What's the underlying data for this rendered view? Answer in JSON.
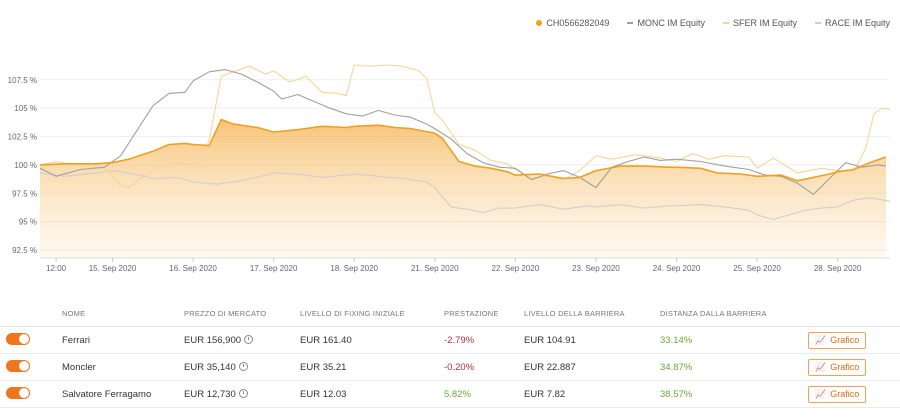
{
  "chart_data": {
    "type": "line",
    "yticks": [
      "107.5 %",
      "105 %",
      "102.5 %",
      "100 %",
      "97.5 %",
      "95 %",
      "92.5 %"
    ],
    "ytick_values": [
      107.5,
      105,
      102.5,
      100,
      97.5,
      95,
      92.5
    ],
    "ylim": [
      91.8,
      110.3
    ],
    "xticks": [
      "12:00",
      "15. Sep 2020",
      "16. Sep 2020",
      "17. Sep 2020",
      "18. Sep 2020",
      "21. Sep 2020",
      "22. Sep 2020",
      "23. Sep 2020",
      "24. Sep 2020",
      "25. Sep 2020",
      "28. Sep 2020"
    ],
    "xtick_positions": [
      0.3,
      1,
      2,
      3,
      4,
      5,
      6,
      7,
      8,
      9,
      10
    ],
    "xlim": [
      0.1,
      10.65
    ],
    "grid": true,
    "legend_position": "top-right",
    "series": [
      {
        "name": "CH0566282049",
        "color": "#f0a020",
        "marker": "dot",
        "fill": true,
        "x": [
          0.1,
          0.4,
          0.8,
          1.0,
          1.2,
          1.5,
          1.7,
          1.9,
          2.0,
          2.2,
          2.35,
          2.5,
          2.8,
          3.0,
          3.3,
          3.6,
          3.9,
          4.0,
          4.3,
          4.5,
          4.7,
          5.0,
          5.1,
          5.3,
          5.5,
          5.7,
          5.9,
          6.0,
          6.3,
          6.6,
          6.8,
          7.0,
          7.3,
          7.6,
          7.9,
          8.0,
          8.3,
          8.5,
          8.8,
          9.0,
          9.3,
          9.5,
          9.7,
          9.9,
          10.0,
          10.2,
          10.4,
          10.6
        ],
        "y": [
          100.0,
          100.1,
          100.1,
          100.2,
          100.5,
          101.2,
          101.8,
          101.9,
          101.8,
          101.7,
          104.0,
          103.6,
          103.3,
          102.9,
          103.1,
          103.4,
          103.3,
          103.4,
          103.5,
          103.3,
          103.2,
          102.8,
          102.3,
          100.3,
          99.9,
          99.7,
          99.4,
          99.1,
          99.2,
          98.8,
          98.9,
          99.5,
          99.9,
          99.9,
          99.8,
          99.8,
          99.7,
          99.3,
          99.2,
          99.0,
          99.1,
          98.6,
          98.9,
          99.2,
          99.4,
          99.6,
          100.2,
          100.7
        ]
      },
      {
        "name": "MONC IM Equity",
        "color": "#a0a0a0",
        "marker": "dash",
        "x": [
          0.1,
          0.3,
          0.6,
          0.9,
          1.1,
          1.3,
          1.5,
          1.7,
          1.9,
          2.0,
          2.2,
          2.4,
          2.6,
          2.8,
          3.0,
          3.1,
          3.3,
          3.5,
          3.7,
          3.9,
          4.1,
          4.3,
          4.5,
          4.7,
          4.9,
          5.0,
          5.2,
          5.4,
          5.6,
          5.8,
          6.0,
          6.2,
          6.4,
          6.6,
          6.8,
          7.0,
          7.2,
          7.4,
          7.6,
          7.8,
          8.0,
          8.3,
          8.6,
          8.9,
          9.1,
          9.3,
          9.5,
          9.7,
          9.9,
          10.1,
          10.3,
          10.5,
          10.6
        ],
        "y": [
          99.7,
          99.0,
          99.6,
          99.8,
          100.8,
          103.0,
          105.2,
          106.3,
          106.4,
          107.4,
          108.2,
          108.4,
          108.0,
          107.3,
          106.5,
          105.8,
          106.2,
          105.6,
          105.0,
          104.5,
          104.3,
          104.8,
          104.4,
          104.2,
          103.6,
          103.2,
          102.3,
          101.0,
          100.2,
          99.8,
          99.7,
          98.7,
          99.2,
          99.5,
          98.9,
          98.0,
          99.8,
          100.3,
          100.7,
          100.4,
          100.5,
          100.3,
          99.9,
          99.6,
          99.1,
          99.0,
          98.4,
          97.4,
          98.8,
          100.2,
          99.8,
          100.0,
          99.9
        ]
      },
      {
        "name": "SFER IM Equity",
        "color": "#f7d59a",
        "marker": "dash",
        "x": [
          0.1,
          0.3,
          0.6,
          0.9,
          1.1,
          1.2,
          1.4,
          1.6,
          1.8,
          1.95,
          2.0,
          2.1,
          2.2,
          2.35,
          2.5,
          2.7,
          2.9,
          3.0,
          3.2,
          3.4,
          3.6,
          3.8,
          3.9,
          4.0,
          4.2,
          4.4,
          4.6,
          4.8,
          4.9,
          5.0,
          5.1,
          5.3,
          5.5,
          5.7,
          5.9,
          6.0,
          6.2,
          6.4,
          6.6,
          6.8,
          7.0,
          7.2,
          7.5,
          7.8,
          8.0,
          8.2,
          8.4,
          8.6,
          8.9,
          9.0,
          9.2,
          9.5,
          9.8,
          10.0,
          10.2,
          10.35,
          10.45,
          10.55,
          10.65
        ],
        "y": [
          100.0,
          100.3,
          99.9,
          99.7,
          98.2,
          98.0,
          99.1,
          99.8,
          100.2,
          100.0,
          100.1,
          100.3,
          102.2,
          107.8,
          108.2,
          108.7,
          108.0,
          108.3,
          107.3,
          107.8,
          106.4,
          106.3,
          106.1,
          108.8,
          108.7,
          108.8,
          108.7,
          108.3,
          107.6,
          104.6,
          103.9,
          101.8,
          101.3,
          100.4,
          100.1,
          99.6,
          98.8,
          99.0,
          98.7,
          99.5,
          100.8,
          100.5,
          100.9,
          100.6,
          100.3,
          101.0,
          100.5,
          100.8,
          100.7,
          99.7,
          100.6,
          99.3,
          99.7,
          99.5,
          99.4,
          101.5,
          104.5,
          105.0,
          104.9
        ]
      },
      {
        "name": "RACE IM Equity",
        "color": "#cfcfcf",
        "marker": "dash",
        "x": [
          0.1,
          0.4,
          0.8,
          1.0,
          1.2,
          1.5,
          1.8,
          2.0,
          2.3,
          2.6,
          2.9,
          3.0,
          3.3,
          3.6,
          3.9,
          4.0,
          4.3,
          4.6,
          4.9,
          5.0,
          5.2,
          5.4,
          5.6,
          5.8,
          6.0,
          6.3,
          6.6,
          6.9,
          7.0,
          7.3,
          7.6,
          7.9,
          8.0,
          8.3,
          8.6,
          8.9,
          9.0,
          9.2,
          9.4,
          9.6,
          9.8,
          10.0,
          10.2,
          10.4,
          10.65
        ],
        "y": [
          99.3,
          99.0,
          99.3,
          99.5,
          99.3,
          98.8,
          98.9,
          98.5,
          98.3,
          98.6,
          99.1,
          99.3,
          99.2,
          98.9,
          99.1,
          99.2,
          99.0,
          98.8,
          98.5,
          98.0,
          96.3,
          96.1,
          95.8,
          96.2,
          96.2,
          96.5,
          96.1,
          96.4,
          96.3,
          96.5,
          96.2,
          96.4,
          96.4,
          96.5,
          96.3,
          96.0,
          95.6,
          95.2,
          95.6,
          96.0,
          96.2,
          96.3,
          96.9,
          97.1,
          96.8
        ]
      }
    ]
  },
  "table": {
    "headers": [
      "NOME",
      "PREZZO DI MERCATO",
      "LIVELLO DI FIXING INIZIALE",
      "PRESTAZIONE",
      "LIVELLO DELLA BARRIERA",
      "DISTANZA DALLA BARRIERA"
    ],
    "button_label": "Grafico",
    "rows": [
      {
        "name": "Ferrari",
        "market_price": "EUR 156,900",
        "fixing": "EUR 161.40",
        "performance": "-2.79%",
        "perf_sign": "neg",
        "barrier": "EUR 104.91",
        "distance": "33.14%"
      },
      {
        "name": "Moncler",
        "market_price": "EUR 35,140",
        "fixing": "EUR 35.21",
        "performance": "-0.20%",
        "perf_sign": "neg",
        "barrier": "EUR 22.887",
        "distance": "34.87%"
      },
      {
        "name": "Salvatore Ferragamo",
        "market_price": "EUR 12,730",
        "fixing": "EUR 12.03",
        "performance": "5.82%",
        "perf_sign": "pos",
        "barrier": "EUR 7.82",
        "distance": "38.57%"
      }
    ]
  },
  "colors": {
    "accent": "#f0761c",
    "negative": "#b0303a",
    "positive": "#6aa83a"
  }
}
